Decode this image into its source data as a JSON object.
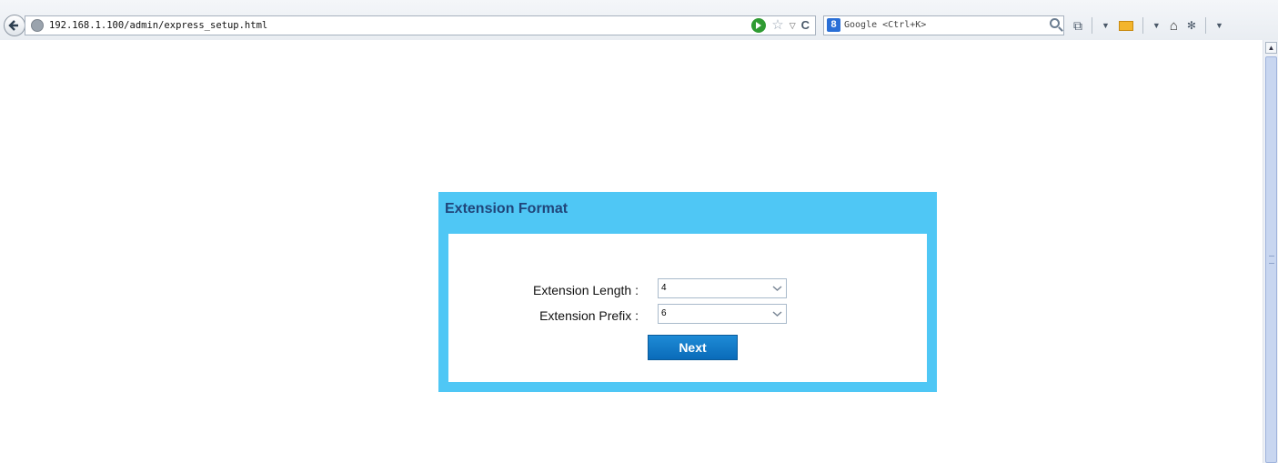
{
  "browser": {
    "url": "192.168.1.100/admin/express_setup.html",
    "search_engine_placeholder": "Google <Ctrl+K>"
  },
  "panel": {
    "title": "Extension Format",
    "extension_length_label": "Extension Length :",
    "extension_length_value": "4",
    "extension_prefix_label": "Extension Prefix :",
    "extension_prefix_value": "6",
    "next_label": "Next"
  },
  "colors": {
    "panel_border": "#4fc7f5",
    "panel_title": "#20457a",
    "button": "#0a6bb9"
  }
}
